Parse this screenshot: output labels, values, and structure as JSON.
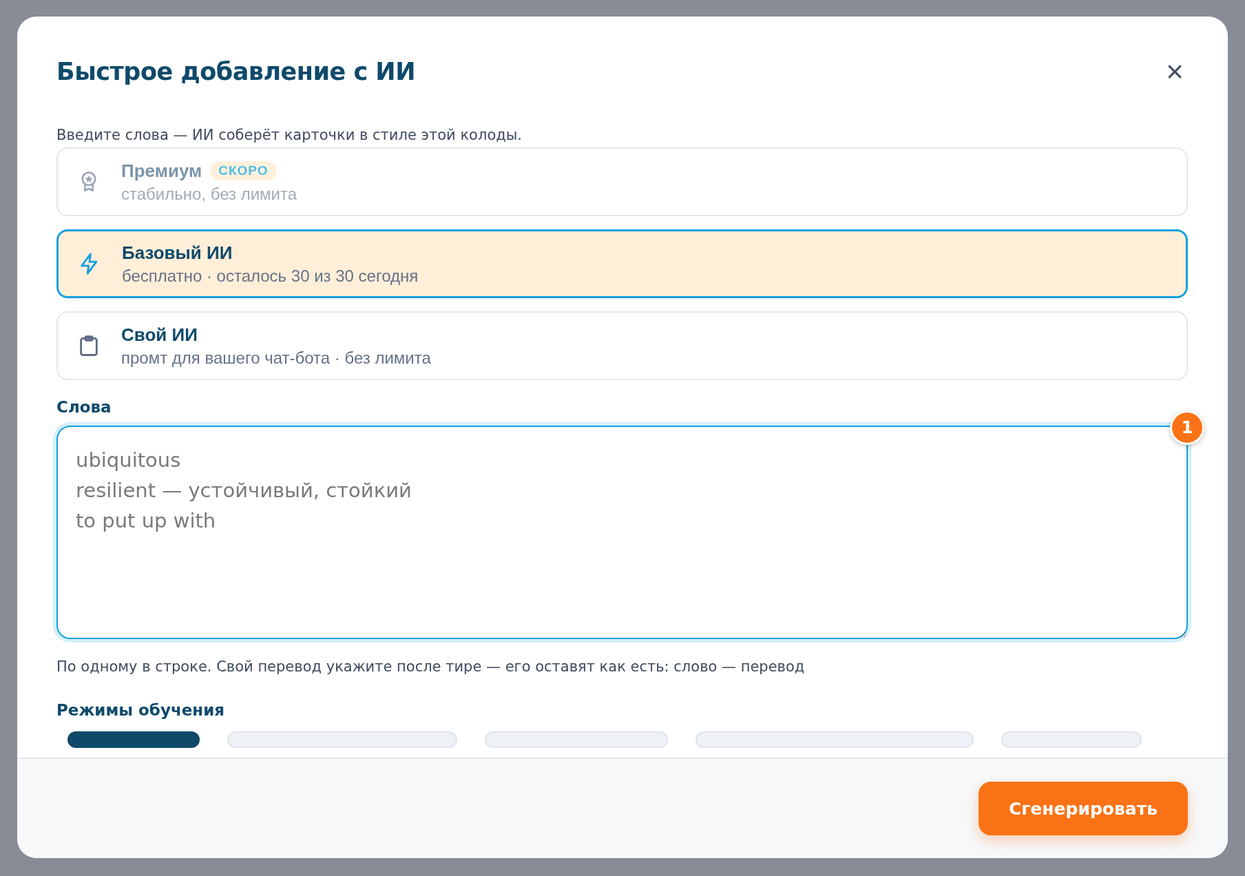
{
  "dialog": {
    "title": "Быстрое добавление с ИИ",
    "close": "×",
    "intro": "Введите слова — ИИ соберёт карточки в стиле этой колоды."
  },
  "options": [
    {
      "kind": "award",
      "title": "Премиум",
      "badge": "СКОРО",
      "subtitle": "стабильно, без лимита",
      "selected": false,
      "disabled": true
    },
    {
      "kind": "bolt",
      "title": "Базовый ИИ",
      "subtitle": "бесплатно · осталось 30 из 30 сегодня",
      "selected": true,
      "disabled": false
    },
    {
      "kind": "clipboard",
      "title": "Свой ИИ",
      "subtitle": "промт для вашего чат-бота · без лимита",
      "selected": false,
      "disabled": false
    }
  ],
  "words": {
    "label": "Слова",
    "placeholder": "ubiquitous\nresilient — устойчивый, стойкий\nto put up with",
    "counter": "1",
    "hint": "По одному в строке. Свой перевод укажите после тире — его оставят как есть: слово — перевод"
  },
  "modes": {
    "label": "Режимы обучения"
  },
  "footer": {
    "button": "Сгенерировать"
  }
}
